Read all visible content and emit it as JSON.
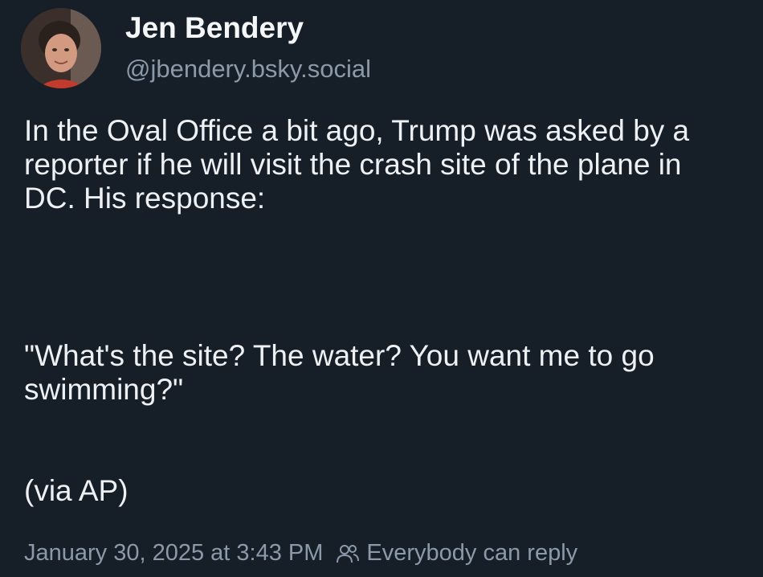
{
  "author": {
    "display_name": "Jen Bendery",
    "handle": "@jbendery.bsky.social",
    "avatar_icon": "user-avatar"
  },
  "post": {
    "paragraphs": [
      "In the Oval Office a bit ago, Trump was asked by a reporter if he will visit the crash site of the plane in DC. His response:",
      "\"What's the site? The water? You want me to go swimming?\"",
      "(via AP)"
    ]
  },
  "meta": {
    "timestamp": "January 30, 2025 at 3:43 PM",
    "reply_setting": "Everybody can reply",
    "reply_icon": "people-icon"
  },
  "colors": {
    "background": "#161e27",
    "text": "#eef1f4",
    "muted": "#8c99a8"
  }
}
